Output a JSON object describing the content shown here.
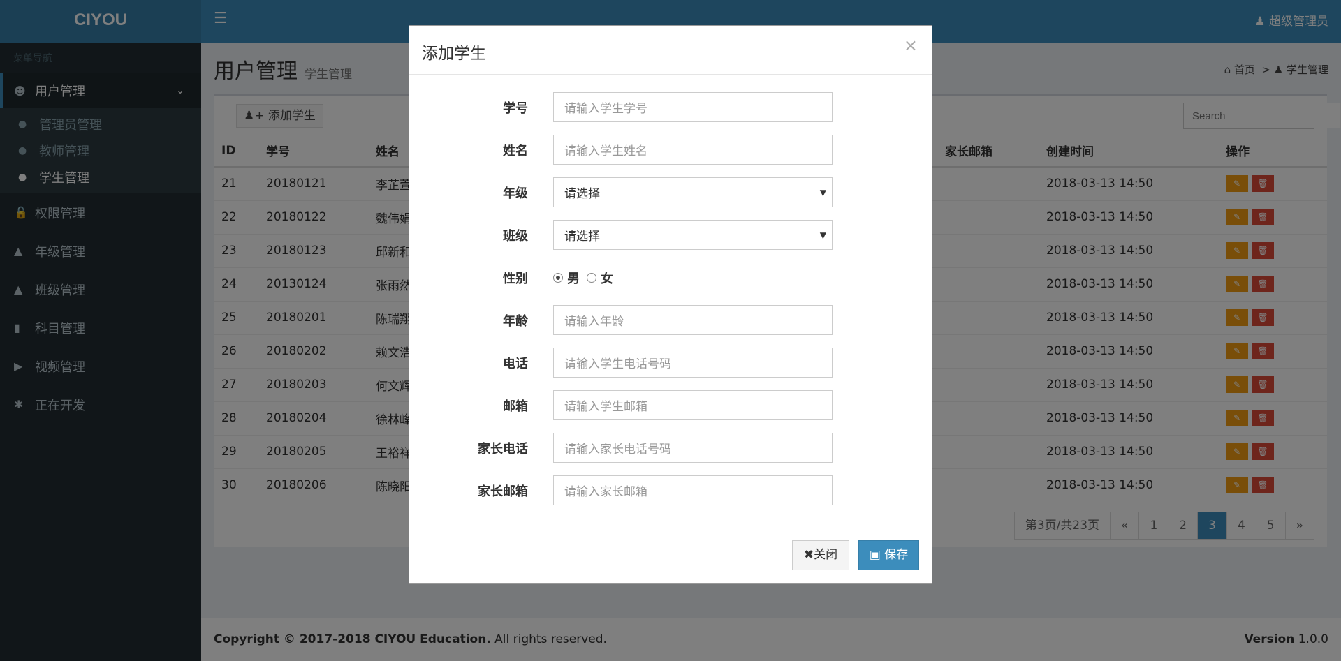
{
  "app": {
    "logo": "CIYOU",
    "user": "超级管理员"
  },
  "sidebar": {
    "header": "菜单导航",
    "items": [
      {
        "label": "用户管理",
        "icon": "users-icon",
        "active": true,
        "sub": [
          {
            "label": "管理员管理"
          },
          {
            "label": "教师管理"
          },
          {
            "label": "学生管理"
          }
        ]
      },
      {
        "label": "权限管理",
        "icon": "unlock-icon"
      },
      {
        "label": "年级管理",
        "icon": "graduation-cap-icon"
      },
      {
        "label": "班级管理",
        "icon": "graduation-cap-icon"
      },
      {
        "label": "科目管理",
        "icon": "book-icon"
      },
      {
        "label": "视频管理",
        "icon": "video-camera-icon"
      },
      {
        "label": "正在开发",
        "icon": "spinner-icon"
      }
    ]
  },
  "page": {
    "title": "用户管理",
    "subtitle": "学生管理",
    "breadcrumb": [
      "首页",
      "学生管理"
    ]
  },
  "toolbar": {
    "add_label": "添加学生",
    "search_placeholder": "Search"
  },
  "table": {
    "headers": [
      "ID",
      "学号",
      "姓名",
      "家长邮箱",
      "创建时间",
      "操作"
    ],
    "rows": [
      {
        "id": "21",
        "no": "20180121",
        "name": "李芷萱",
        "time": "2018-03-13 14:50"
      },
      {
        "id": "22",
        "no": "20180122",
        "name": "魏伟娟",
        "time": "2018-03-13 14:50"
      },
      {
        "id": "23",
        "no": "20180123",
        "name": "邱新和",
        "time": "2018-03-13 14:50"
      },
      {
        "id": "24",
        "no": "20130124",
        "name": "张雨然",
        "time": "2018-03-13 14:50"
      },
      {
        "id": "25",
        "no": "20180201",
        "name": "陈瑞翔",
        "time": "2018-03-13 14:50"
      },
      {
        "id": "26",
        "no": "20180202",
        "name": "赖文浩",
        "time": "2018-03-13 14:50"
      },
      {
        "id": "27",
        "no": "20180203",
        "name": "何文辉",
        "time": "2018-03-13 14:50"
      },
      {
        "id": "28",
        "no": "20180204",
        "name": "徐林峰",
        "time": "2018-03-13 14:50"
      },
      {
        "id": "29",
        "no": "20180205",
        "name": "王裕祥",
        "time": "2018-03-13 14:50"
      },
      {
        "id": "30",
        "no": "20180206",
        "name": "陈晓阳",
        "time": "2018-03-13 14:50"
      }
    ]
  },
  "pager": {
    "info": "第3页/共23页",
    "prev": "«",
    "pages": [
      "1",
      "2",
      "3",
      "4",
      "5"
    ],
    "current": "3",
    "next": "»"
  },
  "footer": {
    "copyright_bold": "Copyright © 2017-2018 CIYOU Education.",
    "copyright_rest": " All rights reserved.",
    "version_label": "Version",
    "version": " 1.0.0"
  },
  "modal": {
    "title": "添加学生",
    "close": "×",
    "fields": [
      {
        "label": "学号",
        "placeholder": "请输入学生学号"
      },
      {
        "label": "姓名",
        "placeholder": "请输入学生姓名"
      },
      {
        "label": "年级",
        "select": "请选择"
      },
      {
        "label": "班级",
        "select": "请选择"
      },
      {
        "label": "性别",
        "radios": [
          "男",
          "女"
        ],
        "checked": "男"
      },
      {
        "label": "年龄",
        "placeholder": "请输入年龄"
      },
      {
        "label": "电话",
        "placeholder": "请输入学生电话号码"
      },
      {
        "label": "邮箱",
        "placeholder": "请输入学生邮箱"
      },
      {
        "label": "家长电话",
        "placeholder": "请输入家长电话号码"
      },
      {
        "label": "家长邮箱",
        "placeholder": "请输入家长邮箱"
      }
    ],
    "close_btn": "关闭",
    "save_btn": "保存"
  },
  "colors": {
    "primary": "#3c8dbc",
    "edit": "#f39c12",
    "delete": "#dd4b39",
    "sidebar": "#222d32"
  }
}
